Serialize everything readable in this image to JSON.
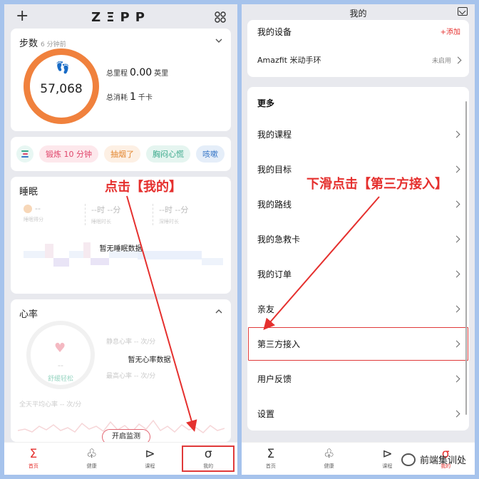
{
  "left": {
    "logo": "ΖΞΡΡ",
    "steps": {
      "title": "步数",
      "subtitle": "6 分钟前",
      "count": "57,068",
      "distance_label": "总里程",
      "distance_value": "0.00",
      "distance_unit": "英里",
      "calories_label": "总消耗",
      "calories_value": "1",
      "calories_unit": "千卡"
    },
    "chips": [
      "锻炼 10 分钟",
      "抽烟了",
      "胸闷心慌",
      "咳嗽"
    ],
    "sleep": {
      "title": "睡眠",
      "cols": [
        {
          "value": "--",
          "label": "睡眠得分"
        },
        {
          "value": "--时 --分",
          "label": "睡眠时长"
        },
        {
          "value": "--时 --分",
          "label": "深睡时长"
        }
      ],
      "no_data": "暂无睡眠数据"
    },
    "heart": {
      "title": "心率",
      "center_dash": "--",
      "center_label": "舒缓轻松",
      "resting": "静息心率 -- 次/分",
      "no_data": "暂无心率数据",
      "max": "最高心率 -- 次/分",
      "allday": "全天平均心率 -- 次/分",
      "start_button": "开启监测"
    },
    "tabs": [
      {
        "icon": "Σ",
        "label": "首页"
      },
      {
        "icon": "♧",
        "label": "健康"
      },
      {
        "icon": "⊳",
        "label": "课程"
      },
      {
        "icon": "σ",
        "label": "我的"
      }
    ]
  },
  "right": {
    "title": "我的",
    "devices_title": "我的设备",
    "add_label": "+添加",
    "device_name": "Amazfit 米动手环",
    "device_status": "未启用",
    "more_title": "更多",
    "menu": [
      "我的课程",
      "我的目标",
      "我的路线",
      "我的急救卡",
      "我的订单",
      "亲友",
      "第三方接入",
      "用户反馈",
      "设置"
    ],
    "tabs": [
      {
        "icon": "Σ",
        "label": "首页"
      },
      {
        "icon": "♧",
        "label": "健康"
      },
      {
        "icon": "⊳",
        "label": "课程"
      },
      {
        "icon": "σ",
        "label": "我的"
      }
    ]
  },
  "annotations": {
    "left": "点击【我的】",
    "right": "下滑点击【第三方接入】",
    "accent": "#e5302e"
  },
  "watermark": "前端集训处"
}
